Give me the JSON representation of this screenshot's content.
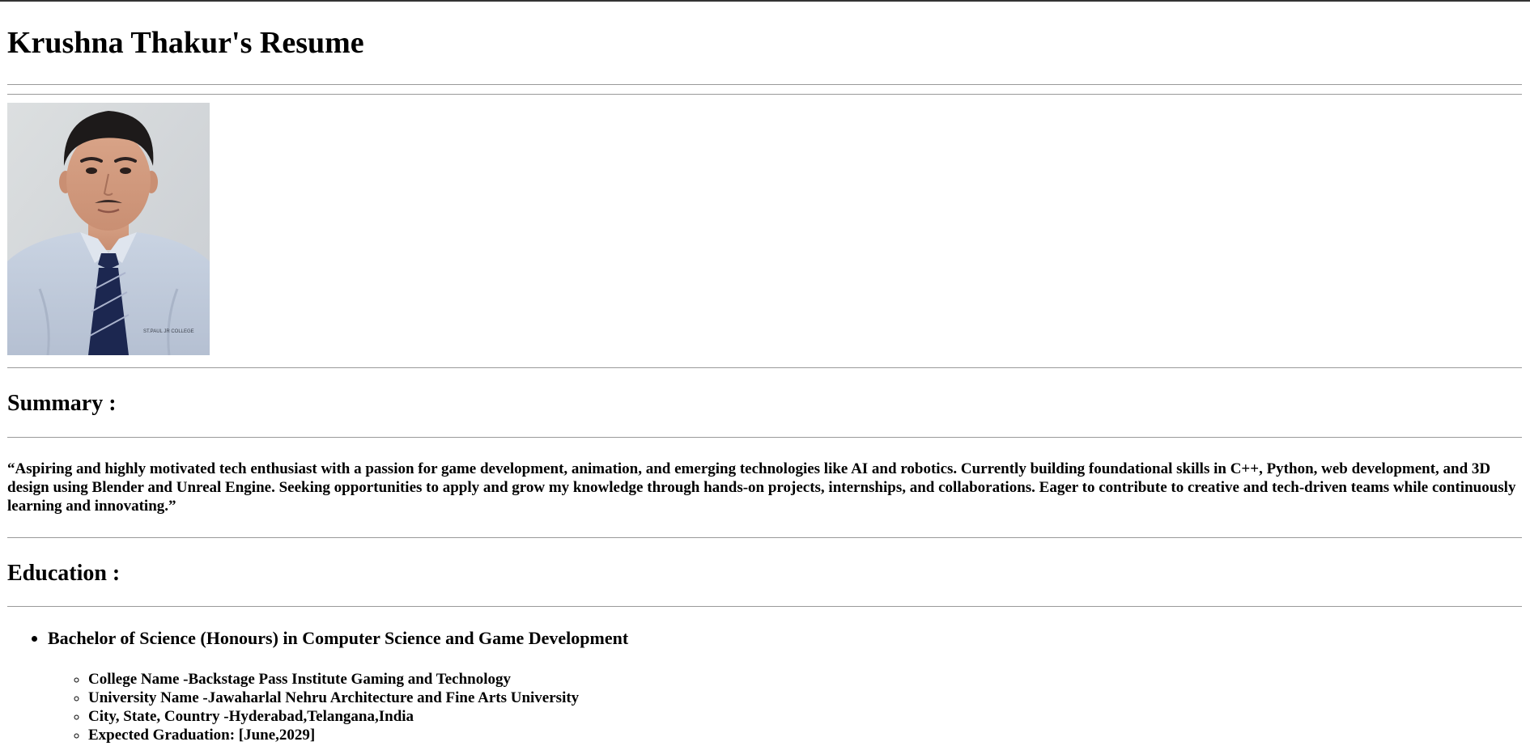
{
  "header": {
    "title": "Krushna Thakur's Resume"
  },
  "profile_photo": {
    "icon": "profile-photo",
    "shirt_text": "ST.PAUL JR COLLEGE"
  },
  "summary": {
    "heading": "Summary :",
    "text": "“Aspiring and highly motivated tech enthusiast with a passion for game development, animation, and emerging technologies like AI and robotics. Currently building foundational skills in C++, Python, web development, and 3D design using Blender and Unreal Engine. Seeking opportunities to apply and grow my knowledge through hands-on projects, internships, and collaborations. Eager to contribute to creative and tech-driven teams while continuously learning and innovating.”"
  },
  "education": {
    "heading": "Education :",
    "degree": "Bachelor of Science (Honours) in Computer Science and Game Development",
    "details": [
      "College Name -Backstage Pass Institute Gaming and Technology",
      "University Name -Jawaharlal Nehru Architecture and Fine Arts University",
      "City, State, Country -Hyderabad,Telangana,India",
      "Expected Graduation: [June,2029]"
    ]
  }
}
